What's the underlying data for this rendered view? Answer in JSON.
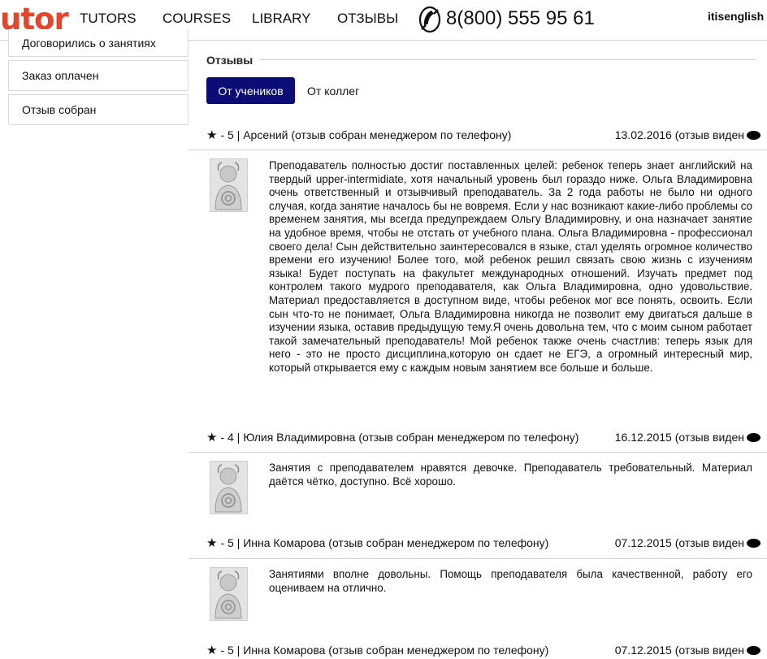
{
  "header": {
    "logo": "utor",
    "nav": [
      "TUTORS",
      "COURSES",
      "LIBRARY",
      "ОТЗЫВЫ"
    ],
    "phone": "8(800) 555 95 61",
    "user": "itisenglish"
  },
  "sidebar": {
    "items": [
      "Договорились о занятиях",
      "Заказ оплачен",
      "Отзыв собран"
    ]
  },
  "reviews": {
    "title": "Отзывы",
    "tabs": [
      "От учеников",
      "От коллег"
    ],
    "items": [
      {
        "rating_text": "- 5 | Арсений (отзыв собран менеджером по телефону)",
        "date_text": "13.02.2016 (отзыв виден",
        "text": "Преподаватель полностью достиг поставленных целей: ребенок теперь знает английский на твердый upper-intermidiate, хотя начальный уровень был гораздо ниже. Ольга Владимировна очень ответственный и отзывчивый преподаватель. За 2 года работы не было ни одного случая, когда занятие началось бы не вовремя. Если у нас возникают какие-либо проблемы со временем занятия, мы всегда предупреждаем Ольгу Владимировну, и она назначает занятие на удобное время, чтобы не отстать от учебного плана. Ольга Владимировна - профессионал своего дела! Сын действительно заинтересовался в языке, стал уделять огромное количество времени его изучению! Более того, мой ребенок решил связать свою жизнь с изучениям языка! Будет поступать на факультет международных отношений. Изучать предмет под контролем такого мудрого преподавателя, как Ольга Владимировна, одно удовольствие. Материал предоставляется в доступном виде, чтобы ребенок мог все понять, освоить. Если сын что-то не понимает, Ольга Владимировна никогда не позволит ему двигаться дальше в изучении языка, оставив предыдущую тему.Я очень довольна тем, что с моим сыном работает такой замечательный преподаватель! Мой ребенок также очень счастлив: теперь язык для него - это не просто дисциплина,которую он сдает не ЕГЭ, а огромный интересный мир, который открывается ему с каждым новым занятием все больше и больше."
      },
      {
        "rating_text": "- 4 | Юлия Владимировна (отзыв собран менеджером по телефону)",
        "date_text": "16.12.2015 (отзыв виден",
        "text": "Занятия с преподавателем нравятся девочке. Преподаватель требовательный. Материал даётся чётко, доступно. Всё хорошо."
      },
      {
        "rating_text": "- 5 | Инна Комарова (отзыв собран менеджером по телефону)",
        "date_text": "07.12.2015 (отзыв виден",
        "text": "Занятиями вполне довольны. Помощь преподавателя была качественной, работу его оцениваем на отлично."
      },
      {
        "rating_text": "- 5 | Инна Комарова (отзыв собран менеджером по телефону)",
        "date_text": "07.12.2015 (отзыв виден",
        "text": ""
      }
    ]
  },
  "icons": {
    "star": "star-icon",
    "eye": "eye-icon",
    "phone": "phone-icon",
    "avatar": "avatar-icon"
  },
  "colors": {
    "logo": "#e6452a",
    "active_tab": "#0c0c76"
  }
}
